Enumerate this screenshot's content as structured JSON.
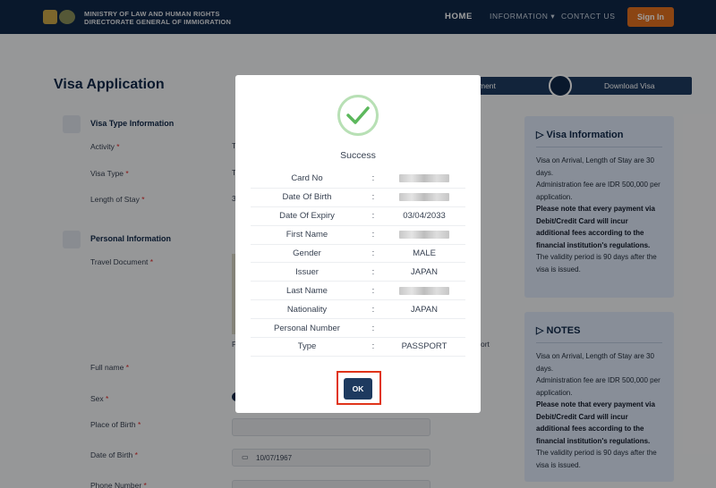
{
  "header": {
    "org_line1": "MINISTRY OF LAW AND HUMAN RIGHTS",
    "org_line2": "DIRECTORATE GENERAL OF IMMIGRATION",
    "nav_home": "HOME",
    "nav_information": "INFORMATION",
    "nav_contact": "CONTACT US",
    "signin_label": "Sign In"
  },
  "page": {
    "title": "Visa Application",
    "steps": {
      "step_partial": "ment",
      "step_download": "Download Visa"
    },
    "visa_section": {
      "heading": "Visa Type Information",
      "labels": [
        "Activity",
        "Visa Type",
        "Length of Stay"
      ],
      "value_stubs": [
        "T",
        "T",
        "3"
      ]
    },
    "personal_section": {
      "heading": "Personal Information",
      "travel_document_label": "Travel Document",
      "stub_p": "P",
      "stub_ort": "ort",
      "labels": [
        "Full name",
        "Sex",
        "Place of Birth",
        "Date of Birth",
        "Phone Number"
      ],
      "dob_value": "10/07/1967"
    },
    "required_mark": "*"
  },
  "sidebar": {
    "visa_info": {
      "title": "Visa Information",
      "line1": "Visa on Arrival, Length of Stay are 30 days.",
      "line2": "Administration fee are IDR 500,000 per application.",
      "bold": "Please note that every payment via Debit/Credit Card will incur additional fees according to the financial institution's regulations.",
      "line3": "The validity period is 90 days after the visa is issued."
    },
    "notes": {
      "title": "NOTES",
      "line1": "Visa on Arrival, Length of Stay are 30 days.",
      "line2": "Administration fee are IDR 500,000 per application.",
      "bold": "Please note that every payment via Debit/Credit Card will incur additional fees according to the financial institution's regulations.",
      "line3": "The validity period is 90 days after the visa is issued."
    }
  },
  "modal": {
    "status": "Success",
    "separator": ":",
    "rows": [
      {
        "key": "Card No",
        "value": "",
        "redacted": true
      },
      {
        "key": "Date Of Birth",
        "value": "",
        "redacted": true
      },
      {
        "key": "Date Of Expiry",
        "value": "03/04/2033",
        "redacted": false
      },
      {
        "key": "First Name",
        "value": "",
        "redacted": true
      },
      {
        "key": "Gender",
        "value": "MALE",
        "redacted": false
      },
      {
        "key": "Issuer",
        "value": "JAPAN",
        "redacted": false
      },
      {
        "key": "Last Name",
        "value": "",
        "redacted": true
      },
      {
        "key": "Nationality",
        "value": "JAPAN",
        "redacted": false
      },
      {
        "key": "Personal Number",
        "value": "",
        "redacted": false
      },
      {
        "key": "Type",
        "value": "PASSPORT",
        "redacted": false
      }
    ],
    "ok_label": "OK"
  },
  "colors": {
    "navy": "#0f2748",
    "accent": "#e0701f",
    "success_green": "#5cb85c",
    "highlight_red": "#e0341a"
  }
}
